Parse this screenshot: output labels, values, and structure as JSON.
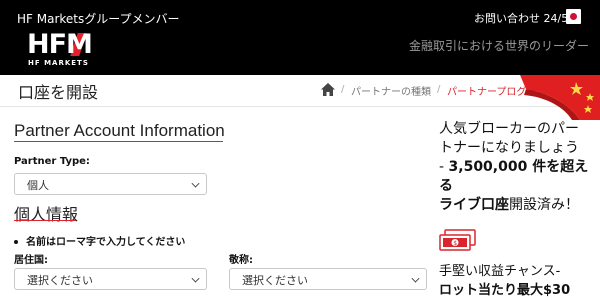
{
  "header": {
    "group_member": "HF Marketsグループメンバー",
    "contact": "お問い合わせ 24/5",
    "language_flag": "japan-flag-icon",
    "logo_mark": "HFM",
    "logo_sub": "HF MARKETS",
    "tagline": "金融取引における世界のリーダー"
  },
  "breadcrumb": {
    "page_title": "口座を開設",
    "home_icon": "home-icon",
    "separator": "/",
    "items": [
      "パートナーの種類",
      "パートナープログラム..."
    ]
  },
  "form": {
    "section_title": "Partner Account Information",
    "partner_type_label": "Partner Type:",
    "partner_type_value": "個人",
    "personal_title": "個人情報",
    "note": "名前はローマ字で入力してください",
    "residence_label": "居住国:",
    "residence_value": "選択ください",
    "honorific_label": "敬称:",
    "honorific_value": "選択ください"
  },
  "sidebar": {
    "promo_line1": "人気ブローカーのパー",
    "promo_line2": "トナーになりましょう",
    "promo_line3_prefix": "- ",
    "promo_line3_bold": "3,500,000 件を超える",
    "promo_line4_bold": "ライブ口座",
    "promo_line4_rest": "開設済み！",
    "cash_icon": "cash-icon",
    "promo2_line1": "手堅い収益チャンス-",
    "promo2_line2_bold": "ロット当たり最大$30"
  },
  "colors": {
    "header_bg": "#000000",
    "accent_red": "#d9262e",
    "tagline_gray": "#9a9a9a"
  }
}
